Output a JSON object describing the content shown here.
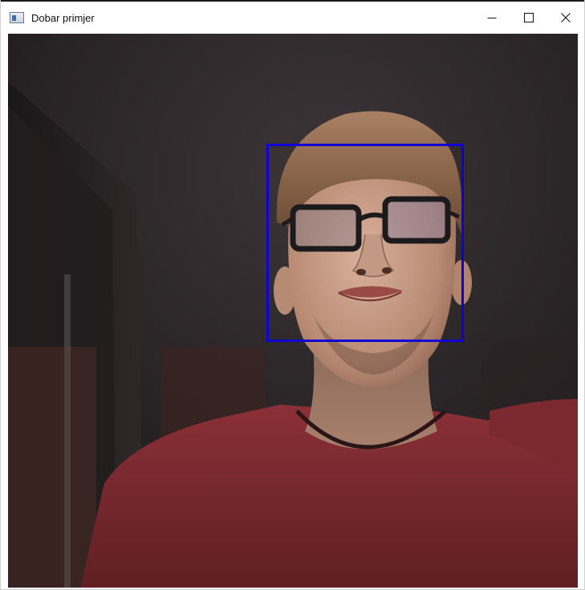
{
  "window": {
    "title": "Dobar primjer",
    "icon": "app-window-icon",
    "controls": [
      {
        "name": "minimize-button",
        "icon": "minimize-icon"
      },
      {
        "name": "maximize-button",
        "icon": "maximize-icon"
      },
      {
        "name": "close-button",
        "icon": "close-icon"
      }
    ]
  },
  "detection": {
    "shape": "rectangle",
    "color": "#1100d6"
  },
  "colors": {
    "shirt": "#7a2a2e",
    "skin": "#c9a08a",
    "hair": "#8a6446",
    "background": "#2b2628"
  }
}
